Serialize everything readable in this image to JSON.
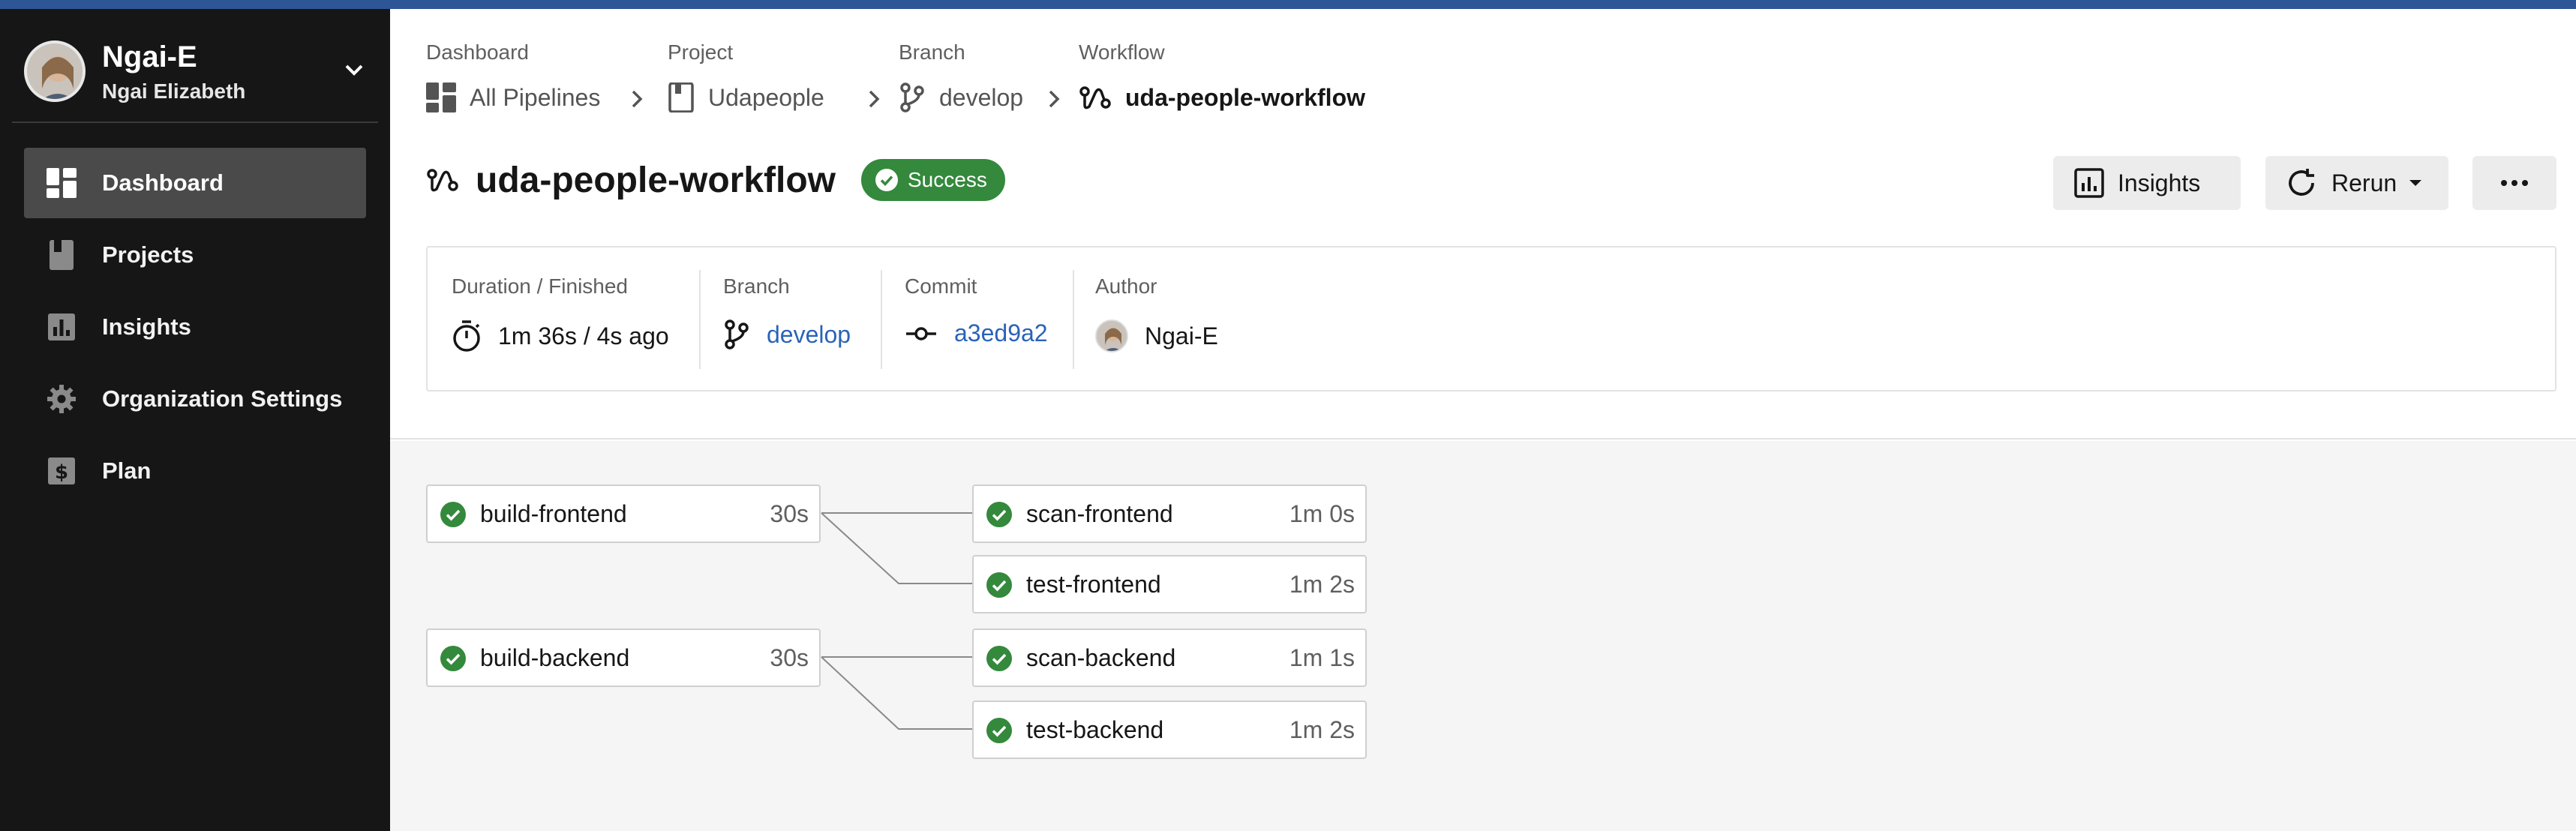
{
  "user": {
    "handle": "Ngai-E",
    "full_name": "Ngai Elizabeth"
  },
  "sidebar": {
    "items": [
      {
        "label": "Dashboard",
        "icon": "dashboard-icon",
        "active": true
      },
      {
        "label": "Projects",
        "icon": "book-icon",
        "active": false
      },
      {
        "label": "Insights",
        "icon": "bar-chart-icon",
        "active": false
      },
      {
        "label": "Organization Settings",
        "icon": "gear-icon",
        "active": false
      },
      {
        "label": "Plan",
        "icon": "dollar-icon",
        "active": false
      }
    ]
  },
  "breadcrumb": {
    "dashboard": {
      "caption": "Dashboard",
      "value": "All Pipelines"
    },
    "project": {
      "caption": "Project",
      "value": "Udapeople"
    },
    "branch": {
      "caption": "Branch",
      "value": "develop"
    },
    "workflow": {
      "caption": "Workflow",
      "value": "uda-people-workflow"
    }
  },
  "workflow": {
    "title": "uda-people-workflow",
    "status": "Success"
  },
  "actions": {
    "insights_label": "Insights",
    "rerun_label": "Rerun"
  },
  "info": {
    "duration_caption": "Duration / Finished",
    "duration_value": "1m 36s / 4s ago",
    "branch_caption": "Branch",
    "branch_value": "develop",
    "commit_caption": "Commit",
    "commit_value": "a3ed9a2",
    "author_caption": "Author",
    "author_value": "Ngai-E"
  },
  "jobs": [
    {
      "name": "build-frontend",
      "duration": "30s"
    },
    {
      "name": "scan-frontend",
      "duration": "1m 0s"
    },
    {
      "name": "test-frontend",
      "duration": "1m 2s"
    },
    {
      "name": "build-backend",
      "duration": "30s"
    },
    {
      "name": "scan-backend",
      "duration": "1m 1s"
    },
    {
      "name": "test-backend",
      "duration": "1m 2s"
    }
  ],
  "colors": {
    "accent": "#2e5596",
    "success": "#34893c",
    "link": "#2a63b8",
    "sidebar": "#161616"
  }
}
